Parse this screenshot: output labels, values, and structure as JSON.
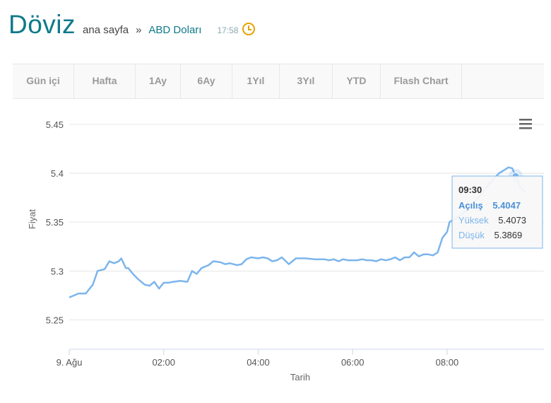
{
  "header": {
    "brand": "Döviz",
    "crumb_home": "ana sayfa",
    "crumb_sep": "»",
    "crumb_current": "ABD Doları",
    "time": "17:58",
    "clock_icon": "clock-icon"
  },
  "tabs": [
    "Gün içi",
    "Hafta",
    "1Ay",
    "6Ay",
    "1Yıl",
    "3Yıl",
    "YTD",
    "Flash Chart"
  ],
  "menu_icon": "hamburger-menu-icon",
  "chart_data": {
    "type": "line",
    "xlabel": "Tarih",
    "ylabel": "Fiyat",
    "ylim": [
      5.22,
      5.46
    ],
    "yticks": [
      5.25,
      5.3,
      5.35,
      5.4,
      5.45
    ],
    "ytick_labels": [
      "5.25",
      "5.3",
      "5.35",
      "5.4",
      "5.45"
    ],
    "xlim": [
      0,
      9.9
    ],
    "xticks": [
      0,
      2,
      4,
      6,
      8
    ],
    "xtick_labels": [
      "9. Ağu",
      "02:00",
      "04:00",
      "06:00",
      "08:00"
    ],
    "grid": true,
    "line_color": "#7cb5ec",
    "series": [
      {
        "x": [
          0,
          0.1,
          0.2,
          0.35,
          0.5,
          0.6,
          0.75,
          0.85,
          0.95,
          1.05,
          1.1,
          1.2,
          1.25,
          1.35,
          1.45,
          1.55,
          1.6,
          1.7,
          1.8,
          1.9,
          2.0,
          2.1,
          2.2,
          2.35,
          2.5,
          2.6,
          2.7,
          2.8,
          2.95,
          3.05,
          3.2,
          3.3,
          3.4,
          3.55,
          3.65,
          3.75,
          3.85,
          4.0,
          4.1,
          4.2,
          4.3,
          4.4,
          4.5,
          4.65,
          4.8,
          5.0,
          5.2,
          5.4,
          5.5,
          5.6,
          5.7,
          5.8,
          5.9,
          6.0,
          6.1,
          6.2,
          6.3,
          6.4,
          6.5,
          6.6,
          6.7,
          6.8,
          6.9,
          7.0,
          7.1,
          7.2,
          7.3,
          7.4,
          7.5,
          7.6,
          7.7,
          7.8,
          7.9,
          8.0,
          8.05,
          8.15,
          8.25,
          8.4,
          8.55,
          8.7,
          8.85,
          9.0,
          9.1,
          9.2,
          9.3,
          9.38,
          9.45,
          9.55,
          9.65
        ],
        "values": [
          5.273,
          5.275,
          5.277,
          5.277,
          5.286,
          5.3,
          5.302,
          5.31,
          5.308,
          5.31,
          5.313,
          5.303,
          5.303,
          5.297,
          5.292,
          5.288,
          5.286,
          5.285,
          5.289,
          5.282,
          5.288,
          5.288,
          5.289,
          5.29,
          5.289,
          5.3,
          5.297,
          5.303,
          5.306,
          5.31,
          5.309,
          5.307,
          5.308,
          5.306,
          5.307,
          5.312,
          5.314,
          5.313,
          5.314,
          5.313,
          5.31,
          5.311,
          5.314,
          5.307,
          5.313,
          5.313,
          5.312,
          5.312,
          5.311,
          5.312,
          5.31,
          5.312,
          5.311,
          5.311,
          5.311,
          5.312,
          5.311,
          5.311,
          5.31,
          5.312,
          5.311,
          5.312,
          5.314,
          5.311,
          5.314,
          5.314,
          5.319,
          5.315,
          5.317,
          5.317,
          5.316,
          5.319,
          5.334,
          5.34,
          5.35,
          5.353,
          5.356,
          5.362,
          5.37,
          5.377,
          5.387,
          5.395,
          5.4,
          5.403,
          5.406,
          5.405,
          5.397,
          5.386,
          5.381
        ]
      }
    ],
    "highlight_index": 86,
    "tooltip": {
      "time": "09:30",
      "open_label": "Açılış",
      "open_value": "5.4047",
      "high_label": "Yüksek",
      "high_value": "5.4073",
      "low_label": "Düşük",
      "low_value": "5.3869"
    }
  }
}
